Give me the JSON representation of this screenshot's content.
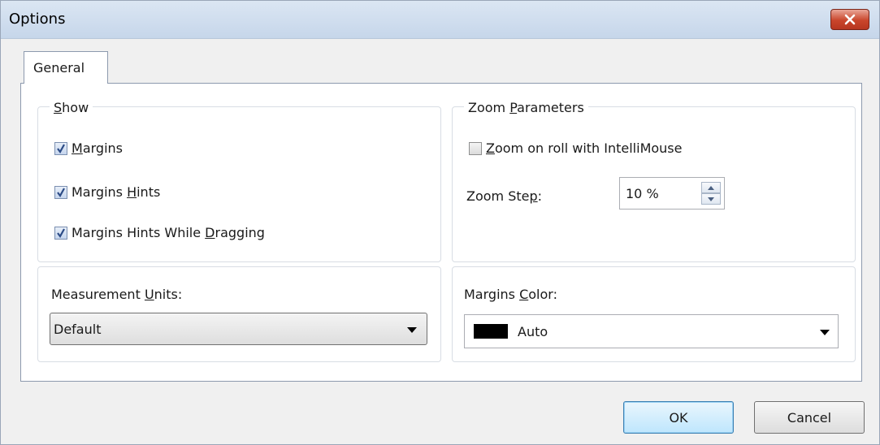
{
  "window": {
    "title": "Options"
  },
  "tabs": [
    {
      "label": "General"
    }
  ],
  "show": {
    "legend": "Show",
    "legend_mnemonic": "S",
    "legend_rest": "how",
    "items": [
      {
        "pre": "",
        "mnemonic": "M",
        "post": "argins",
        "checked": true
      },
      {
        "pre": "Margins ",
        "mnemonic": "H",
        "post": "ints",
        "checked": true
      },
      {
        "pre": "Margins Hints While ",
        "mnemonic": "D",
        "post": "ragging",
        "checked": true
      }
    ]
  },
  "zoom": {
    "legend_pre": "Zoom ",
    "legend_mnemonic": "P",
    "legend_post": "arameters",
    "roll": {
      "pre": "",
      "mnemonic": "Z",
      "post": "oom on roll with IntelliMouse",
      "checked": false
    },
    "step_label_pre": "Zoom Ste",
    "step_label_mnemonic": "p",
    "step_label_post": ":",
    "step_value": "10 %"
  },
  "measurement": {
    "label_pre": "Measurement ",
    "label_mnemonic": "U",
    "label_post": "nits:",
    "value": "Default"
  },
  "margins_color": {
    "label_pre": "Margins ",
    "label_mnemonic": "C",
    "label_post": "olor:",
    "swatch_color": "#000000",
    "value": "Auto"
  },
  "buttons": {
    "ok": "OK",
    "cancel": "Cancel"
  }
}
